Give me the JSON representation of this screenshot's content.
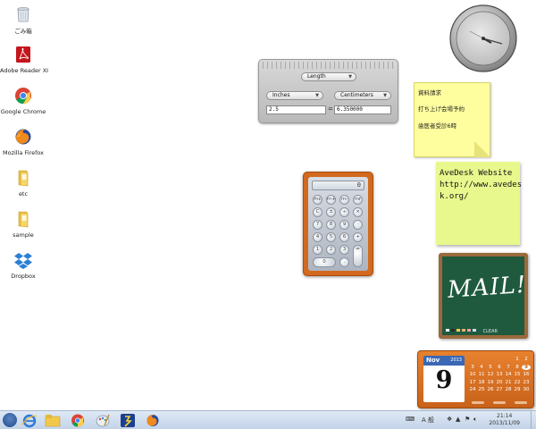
{
  "desktop": {
    "icons": [
      {
        "label": "ごみ箱",
        "icon": "recycle-bin-icon"
      },
      {
        "label": "Adobe Reader XI",
        "icon": "adobe-reader-icon"
      },
      {
        "label": "Google Chrome",
        "icon": "chrome-icon"
      },
      {
        "label": "Mozilla Firefox",
        "icon": "firefox-icon"
      },
      {
        "label": "etc",
        "icon": "folder-icon"
      },
      {
        "label": "sample",
        "icon": "folder-icon"
      },
      {
        "label": "Dropbox",
        "icon": "dropbox-icon"
      }
    ]
  },
  "converter": {
    "mode": "Length",
    "from_unit": "Inches",
    "to_unit": "Centimeters",
    "input_value": "2.5",
    "output_value": "6.350000",
    "equals": "="
  },
  "calculator": {
    "display": "0",
    "keys": [
      "mc",
      "m+",
      "m-",
      "mr",
      "C",
      "±",
      "÷",
      "×",
      "7",
      "8",
      "9",
      "-",
      "4",
      "5",
      "6",
      "+",
      "1",
      "2",
      "3",
      "=",
      "0",
      "."
    ]
  },
  "sticky_note": {
    "lines": [
      "資料請求",
      "打ち上げ会場予約",
      "歯医者受診6時"
    ]
  },
  "avedesk_note": {
    "lines": [
      "AveDesk Website",
      "http://www.avedes",
      "k.org/"
    ]
  },
  "mail_widget": {
    "title": "MAIL!",
    "clear_label": "CLEAR"
  },
  "calendar": {
    "month": "Nov",
    "year": "2013",
    "day": "9",
    "days": [
      "1",
      "2",
      "3",
      "4",
      "5",
      "6",
      "7",
      "8",
      "9",
      "10",
      "11",
      "12",
      "13",
      "14",
      "15",
      "16",
      "17",
      "18",
      "19",
      "20",
      "21",
      "22",
      "23",
      "24",
      "25",
      "26",
      "27",
      "28",
      "29",
      "30"
    ],
    "today": "9"
  },
  "taskbar": {
    "time": "21:14",
    "date": "2013/11/09",
    "tray_text": "A 般"
  },
  "colors": {
    "calculator_frame": "#d2691f",
    "sticky_yellow": "#fffe9e",
    "sticky_green": "#e9f88d",
    "chalkboard": "#1f5a3e",
    "calendar_orange": "#e8812e",
    "calendar_header": "#3a68b4"
  }
}
